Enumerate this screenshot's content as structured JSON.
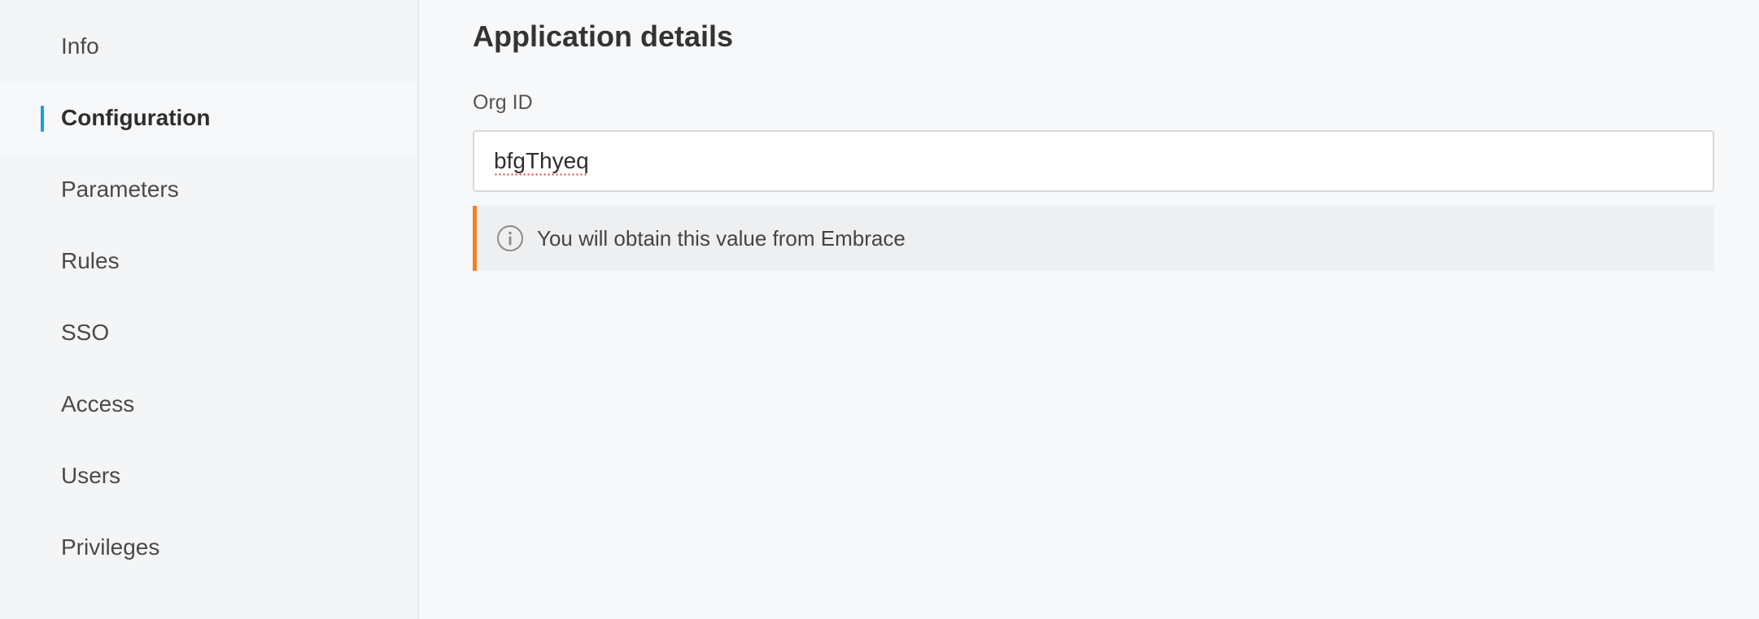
{
  "sidebar": {
    "items": [
      {
        "label": "Info",
        "active": false
      },
      {
        "label": "Configuration",
        "active": true
      },
      {
        "label": "Parameters",
        "active": false
      },
      {
        "label": "Rules",
        "active": false
      },
      {
        "label": "SSO",
        "active": false
      },
      {
        "label": "Access",
        "active": false
      },
      {
        "label": "Users",
        "active": false
      },
      {
        "label": "Privileges",
        "active": false
      }
    ],
    "accent_color": "#1a9fd4"
  },
  "main": {
    "section_title": "Application details",
    "org_id": {
      "label": "Org ID",
      "value": "bfgThyeq"
    },
    "info_notice": {
      "text": "You will obtain this value from Embrace",
      "icon": "info-icon",
      "accent_color": "#f0811f"
    }
  }
}
